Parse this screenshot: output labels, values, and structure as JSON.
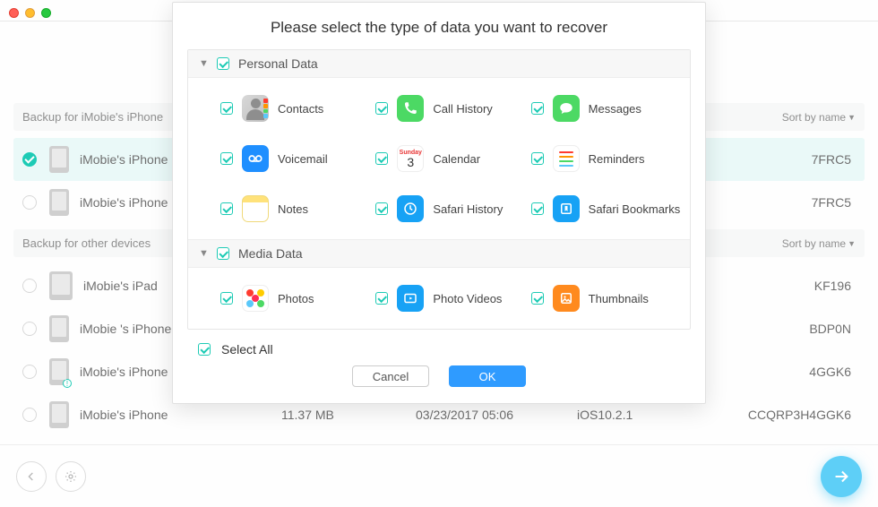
{
  "window": {
    "title": ""
  },
  "modal": {
    "title": "Please select the type of data you want to recover",
    "select_all": "Select All",
    "cancel": "Cancel",
    "ok": "OK",
    "personal": {
      "label": "Personal Data",
      "items": {
        "contacts": "Contacts",
        "call_history": "Call History",
        "messages": "Messages",
        "voicemail": "Voicemail",
        "calendar": "Calendar",
        "reminders": "Reminders",
        "notes": "Notes",
        "safari_history": "Safari History",
        "safari_bookmarks": "Safari Bookmarks"
      },
      "calendar_card": {
        "top": "Sunday",
        "num": "3"
      }
    },
    "media": {
      "label": "Media Data",
      "items": {
        "photos": "Photos",
        "photo_videos": "Photo Videos",
        "thumbnails": "Thumbnails"
      }
    }
  },
  "bg": {
    "section1": {
      "label": "Backup for iMobie's iPhone",
      "sort": "Sort by name"
    },
    "section2": {
      "label": "Backup for other devices",
      "sort": "Sort by name"
    },
    "rows": [
      {
        "name": "iMobie's iPhone",
        "serial_frag": "7FRC5"
      },
      {
        "name": "iMobie's iPhone",
        "serial_frag": "7FRC5"
      },
      {
        "name": "iMobie's iPad",
        "serial_frag": "KF196"
      },
      {
        "name": "iMobie 's iPhone",
        "serial_frag": "BDP0N"
      },
      {
        "name": "iMobie's iPhone",
        "serial_frag": "4GGK6"
      },
      {
        "name": "iMobie's iPhone",
        "size": "11.37 MB",
        "date": "03/23/2017 05:06",
        "os": "iOS10.2.1",
        "serial": "CCQRP3H4GGK6"
      }
    ]
  }
}
